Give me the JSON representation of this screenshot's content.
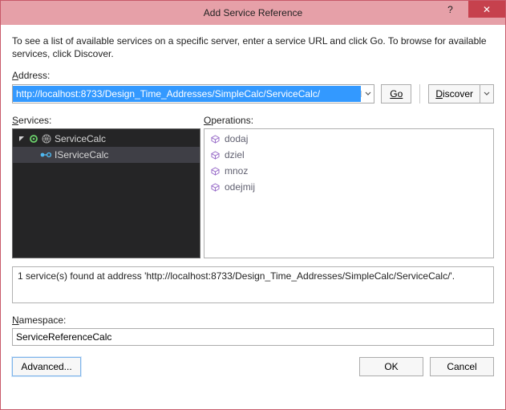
{
  "window": {
    "title": "Add Service Reference",
    "help": "?",
    "close": "✕"
  },
  "intro": "To see a list of available services on a specific server, enter a service URL and click Go. To browse for available services, click Discover.",
  "addressLabelPre": "A",
  "addressLabelRest": "ddress:",
  "addressValue": "http://localhost:8733/Design_Time_Addresses/SimpleCalc/ServiceCalc/",
  "goLabel": "Go",
  "discoverLabel": "Discover",
  "servicesLabelPre": "S",
  "servicesLabelRest": "ervices:",
  "operationsLabelPre": "O",
  "operationsLabelRest": "perations:",
  "tree": {
    "root": "ServiceCalc",
    "child": "IServiceCalc"
  },
  "operations": [
    "dodaj",
    "dziel",
    "mnoz",
    "odejmij"
  ],
  "status": "1 service(s) found at address 'http://localhost:8733/Design_Time_Addresses/SimpleCalc/ServiceCalc/'.",
  "namespaceLabelPre": "N",
  "namespaceLabelRest": "amespace:",
  "namespaceValue": "ServiceReferenceCalc",
  "advancedLabel": "Advanced...",
  "okLabel": "OK",
  "cancelLabel": "Cancel"
}
